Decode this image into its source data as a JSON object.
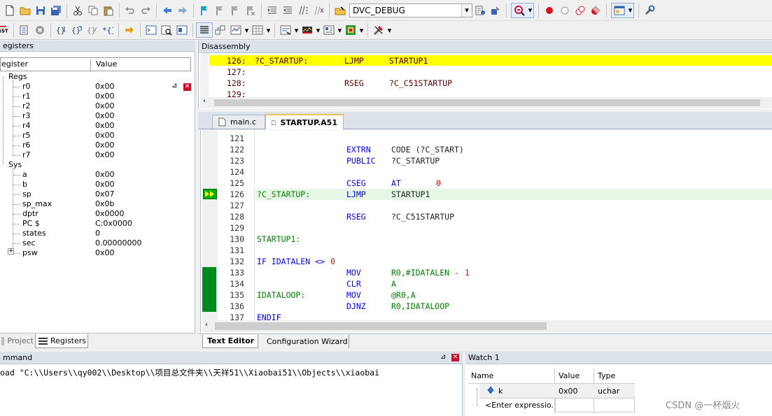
{
  "toolbar": {
    "target": "DVC_DEBUG"
  },
  "panels": {
    "registers_title": "egisters",
    "disassembly_title": "Disassembly",
    "command_title": "mmand",
    "watch_title": "Watch 1"
  },
  "registers": {
    "col_register": "egister",
    "col_value": "Value",
    "group_regs": "Regs",
    "regs": [
      {
        "name": "r0",
        "value": "0x00"
      },
      {
        "name": "r1",
        "value": "0x00"
      },
      {
        "name": "r2",
        "value": "0x00"
      },
      {
        "name": "r3",
        "value": "0x00"
      },
      {
        "name": "r4",
        "value": "0x00"
      },
      {
        "name": "r5",
        "value": "0x00"
      },
      {
        "name": "r6",
        "value": "0x00"
      },
      {
        "name": "r7",
        "value": "0x00"
      }
    ],
    "group_sys": "Sys",
    "sys": [
      {
        "name": "a",
        "value": "0x00"
      },
      {
        "name": "b",
        "value": "0x00"
      },
      {
        "name": "sp",
        "value": "0x07"
      },
      {
        "name": "sp_max",
        "value": "0x0b"
      },
      {
        "name": "dptr",
        "value": "0x0000"
      },
      {
        "name": "PC  $",
        "value": "C:0x0000"
      },
      {
        "name": "states",
        "value": "0"
      },
      {
        "name": "sec",
        "value": "0.00000000"
      },
      {
        "name": "psw",
        "value": "0x00"
      }
    ],
    "psw_expander": "+"
  },
  "left_tabs": {
    "project": "Project",
    "registers": "Registers"
  },
  "disassembly": {
    "lines": [
      {
        "line": "126:",
        "label": "?C_STARTUP:",
        "op": "LJMP",
        "arg": "STARTUP1"
      },
      {
        "line": "127:",
        "label": "",
        "op": "",
        "arg": ""
      },
      {
        "line": "128:",
        "label": "",
        "op": "RSEG",
        "arg": "?C_C51STARTUP"
      },
      {
        "line": "129:",
        "label": "",
        "op": "",
        "arg": ""
      }
    ]
  },
  "editor": {
    "tabs": [
      "main.c",
      "STARTUP.A51"
    ],
    "lines": [
      {
        "n": "121",
        "label": "",
        "op": "",
        "arg": "",
        "num": ""
      },
      {
        "n": "122",
        "label": "",
        "op": "EXTRN",
        "arg": "CODE (?C_START)",
        "num": ""
      },
      {
        "n": "123",
        "label": "",
        "op": "PUBLIC",
        "arg": "?C_STARTUP",
        "num": ""
      },
      {
        "n": "124",
        "label": "",
        "op": "",
        "arg": "",
        "num": ""
      },
      {
        "n": "125",
        "label": "",
        "op": "CSEG",
        "arg": "AT",
        "num": "0"
      },
      {
        "n": "126",
        "label": "?C_STARTUP:",
        "op": "LJMP",
        "arg": "STARTUP1",
        "num": ""
      },
      {
        "n": "127",
        "label": "",
        "op": "",
        "arg": "",
        "num": ""
      },
      {
        "n": "128",
        "label": "",
        "op": "RSEG",
        "arg": "?C_C51STARTUP",
        "num": ""
      },
      {
        "n": "129",
        "label": "",
        "op": "",
        "arg": "",
        "num": ""
      },
      {
        "n": "130",
        "label": "STARTUP1:",
        "op": "",
        "arg": "",
        "num": ""
      },
      {
        "n": "131",
        "label": "",
        "op": "",
        "arg": "",
        "num": ""
      },
      {
        "n": "132",
        "label": "IF IDATALEN <> ",
        "op": "",
        "arg": "",
        "num": "0"
      },
      {
        "n": "133",
        "label": "",
        "op": "MOV",
        "arg": "R0,#IDATALEN - ",
        "num": "1"
      },
      {
        "n": "134",
        "label": "",
        "op": "CLR",
        "arg": "A",
        "num": ""
      },
      {
        "n": "135",
        "label": "IDATALOOP:",
        "op": "MOV",
        "arg": "@R0,A",
        "num": ""
      },
      {
        "n": "136",
        "label": "",
        "op": "DJNZ",
        "arg": "R0,IDATALOOP",
        "num": ""
      },
      {
        "n": "137",
        "label": "ENDIF",
        "op": "",
        "arg": "",
        "num": ""
      }
    ],
    "bottom_tabs": [
      "Text Editor",
      "Configuration Wizard"
    ]
  },
  "command": {
    "text": "oad \"C:\\\\Users\\\\qy002\\\\Desktop\\\\项目总文件夹\\\\天祥51\\\\Xiaobai51\\\\Objects\\\\xiaobai"
  },
  "watch": {
    "col_name": "Name",
    "col_value": "Value",
    "col_type": "Type",
    "rows": [
      {
        "name": "k",
        "value": "0x00",
        "type": "uchar"
      },
      {
        "name": "<Enter expressio...",
        "value": "",
        "type": ""
      }
    ]
  },
  "watermark": "CSDN @一杯烟火",
  "colors": {
    "current_line": "#ffff00",
    "exec_arrow": "#00b000",
    "keyword": "#0000ff",
    "label": "#008000",
    "number": "#e30000",
    "coverage": "#008a1e"
  }
}
